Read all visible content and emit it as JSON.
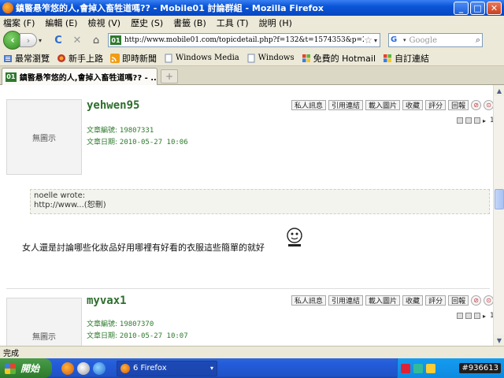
{
  "window": {
    "title": "鎮暋悬笮悠的人,會掉入畜牲道嗎?? - Mobile01 討論群組 - Mozilla Firefox",
    "btn_min": "_",
    "btn_max": "□",
    "btn_close": "✕"
  },
  "menu": [
    "檔案 (F)",
    "編輯 (E)",
    "檢視 (V)",
    "歷史 (S)",
    "書籤 (B)",
    "工具 (T)",
    "說明 (H)"
  ],
  "nav": {
    "url": "http://www.mobile01.com/topicdetail.php?f=132&t=1574353&p=2",
    "site_icon": "01",
    "search_placeholder": "Google",
    "search_engine": "G",
    "back_glyph": "‹",
    "fwd_glyph": "›",
    "drop_glyph": "▾",
    "reload_glyph": "C",
    "stop_glyph": "✕",
    "home_glyph": "⌂",
    "star_glyph": "☆",
    "mag_glyph": "⌕"
  },
  "bookmarks": [
    "最常瀏覽",
    "新手上路",
    "即時新聞",
    "Windows Media",
    "Windows",
    "免費的 Hotmail",
    "自訂連結"
  ],
  "tab": {
    "label": "鎮暋悬笮悠的人,會掉入畜牲道嗎?? - ...",
    "icon": "01",
    "new_tab": "+"
  },
  "post_actions": [
    "私人訊息",
    "引用連結",
    "載入圖片",
    "收藏",
    "評分",
    "回報"
  ],
  "post_actions_icons": [
    "⊘",
    "⊙"
  ],
  "page_num": "1",
  "posts": [
    {
      "username": "yehwen95",
      "avatar_text": "無圖示",
      "article_label": "文章編號:",
      "article_no": "19807331",
      "date_label": "文章日期:",
      "date": "2010-05-27 10:06"
    },
    {
      "username": "myvax1",
      "avatar_text": "無圖示",
      "article_label": "文章編號:",
      "article_no": "19807370",
      "date_label": "文章日期:",
      "date": "2010-05-27 10:07"
    }
  ],
  "quote": {
    "author_line": "noelle wrote:",
    "text": "http://www...(恕刪)"
  },
  "reply_text": "女人還是討論哪些化妝品好用哪裡有好看的衣服這些簡單的就好",
  "scroll": {
    "up": "▲",
    "down": "▼"
  },
  "status": "完成",
  "taskbar": {
    "start": "開始",
    "task": "6 Firefox",
    "task_arrow": "▾",
    "clock": "#936613"
  },
  "colors": {
    "accent_green": "#2d6e2d",
    "titlebar_blue": "#0a55d8"
  }
}
